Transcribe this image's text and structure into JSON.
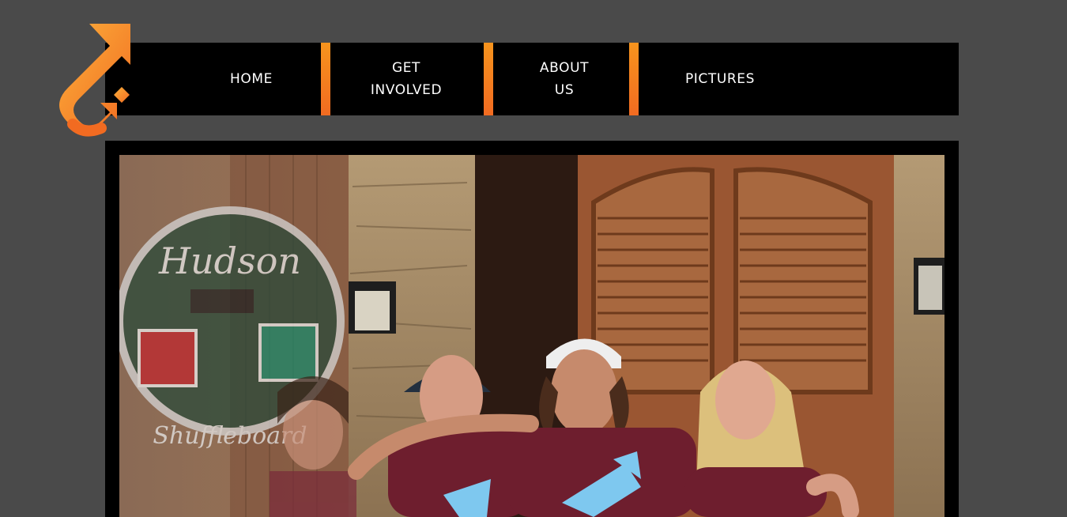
{
  "brand": {
    "logo_icon": "orange-arrow-hook-logo",
    "accent_color": "#f7941d",
    "accent_color_dark": "#f26b21"
  },
  "nav": {
    "items": [
      {
        "label_line1": "HOME",
        "label_line2": ""
      },
      {
        "label_line1": "GET",
        "label_line2": "INVOLVED"
      },
      {
        "label_line1": "ABOUT",
        "label_line2": "US"
      },
      {
        "label_line1": "PICTURES",
        "label_line2": ""
      }
    ]
  },
  "hero": {
    "sign_text": "Hudson",
    "sign_subtext": "Shuffleboard",
    "image_icon": "group-photo-image"
  }
}
